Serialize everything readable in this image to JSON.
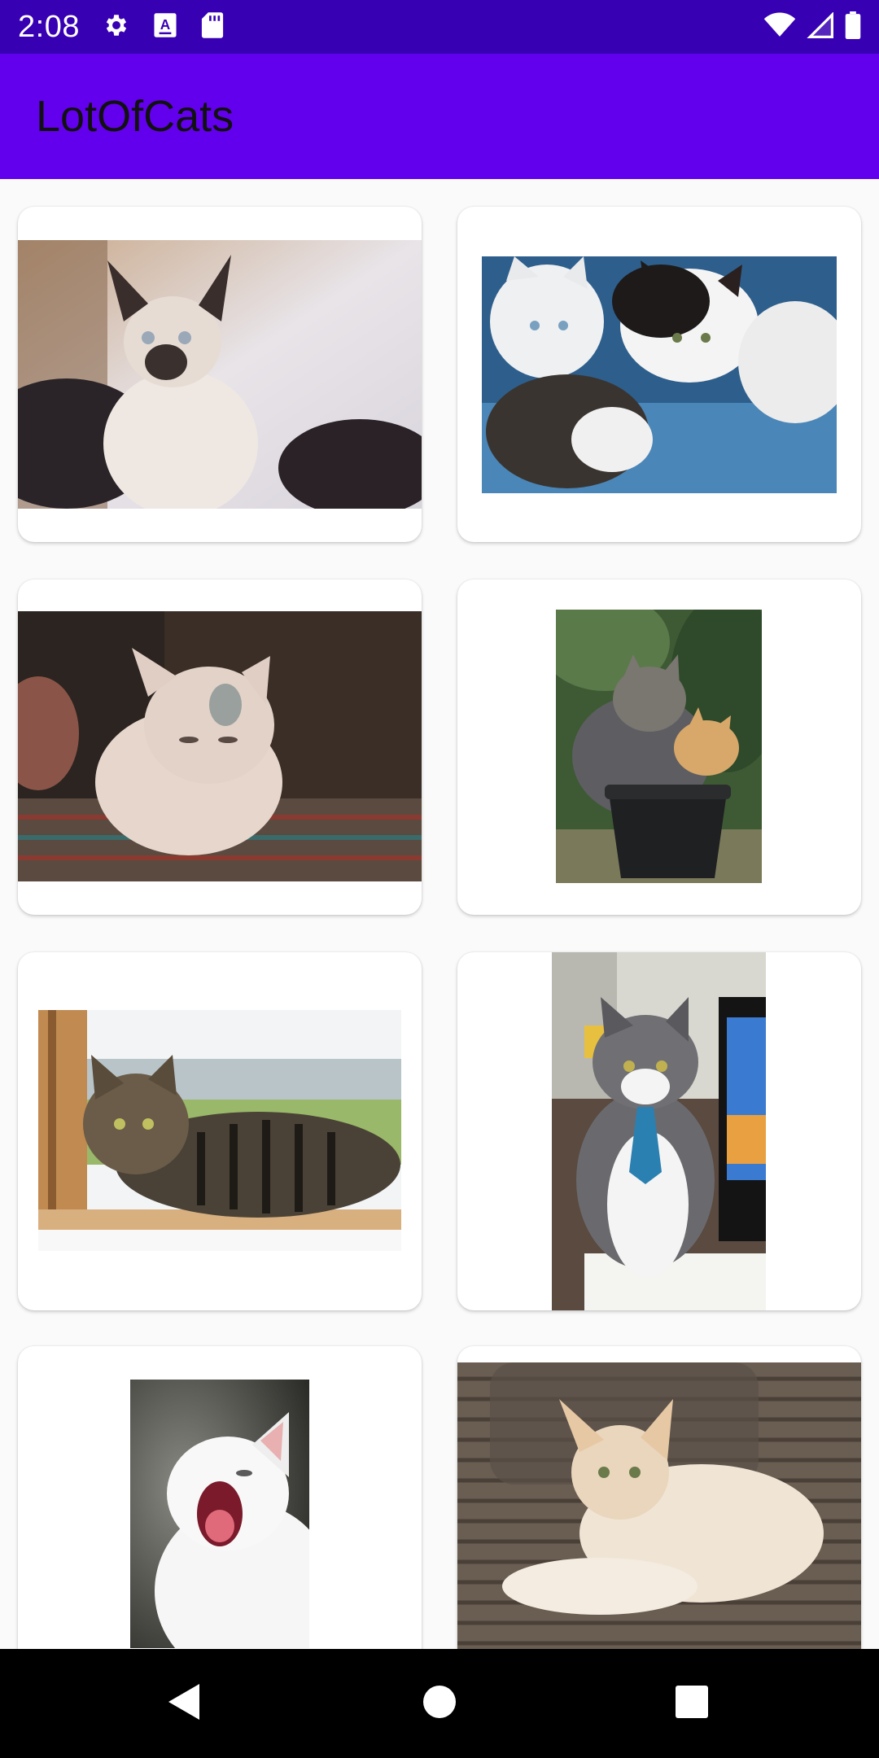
{
  "status_bar": {
    "time": "2:08",
    "left_icons": [
      "settings-icon",
      "a-keyboard-icon",
      "sd-card-icon"
    ],
    "right_icons": [
      "wifi-icon",
      "cell-signal-icon",
      "battery-icon"
    ]
  },
  "app_bar": {
    "title": "LotOfCats"
  },
  "colors": {
    "status_bar": "#3700b3",
    "app_bar": "#6200ee",
    "background": "#fafafa",
    "nav_bar": "#000000"
  },
  "grid": {
    "cards": [
      {
        "photo": "siamese-kitten-on-bed"
      },
      {
        "photo": "four-kittens-in-blue-tub"
      },
      {
        "photo": "cream-cat-on-rug"
      },
      {
        "photo": "two-cats-in-flower-pot"
      },
      {
        "photo": "tabby-cat-in-window"
      },
      {
        "photo": "grey-white-cat-with-tie"
      },
      {
        "photo": "white-cat-yawning"
      },
      {
        "photo": "cream-cat-on-sofa"
      }
    ]
  },
  "nav_bar": {
    "buttons": [
      "back-icon",
      "home-icon",
      "recents-icon"
    ]
  }
}
